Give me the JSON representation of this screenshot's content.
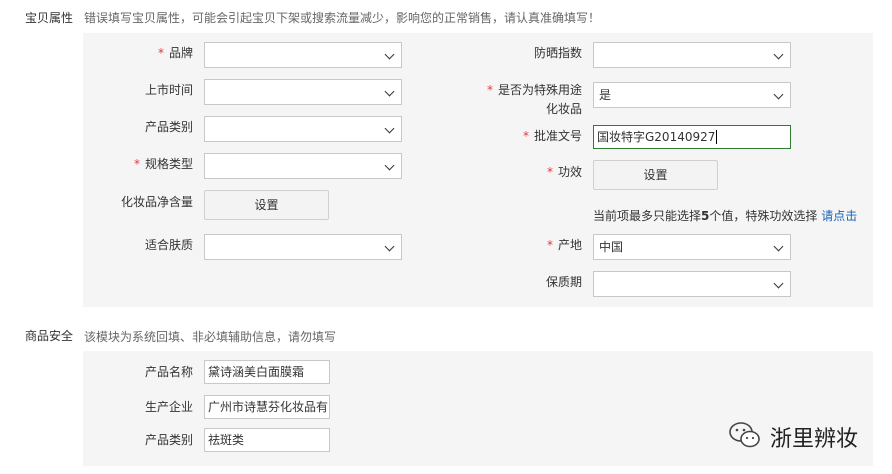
{
  "attributes": {
    "title": "宝贝属性",
    "warning": "错误填写宝贝属性，可能会引起宝贝下架或搜索流量减少，影响您的正常销售，请认真准确填写！",
    "left": {
      "brand": {
        "label": "品牌",
        "value": ""
      },
      "launch_time": {
        "label": "上市时间",
        "value": ""
      },
      "product_category": {
        "label": "产品类别",
        "value": ""
      },
      "spec_type": {
        "label": "规格类型",
        "value": ""
      },
      "net_content": {
        "label": "化妆品净含量",
        "button": "设置"
      },
      "skin_type": {
        "label": "适合肤质",
        "value": ""
      }
    },
    "right": {
      "spf": {
        "label": "防晒指数",
        "value": ""
      },
      "special_use": {
        "label_line1": "是否为特殊用途",
        "label_line2": "化妆品",
        "value": "是"
      },
      "approval_no": {
        "label": "批准文号",
        "value": "国妆特字G20140927"
      },
      "efficacy": {
        "label": "功效",
        "button": "设置"
      },
      "efficacy_hint": {
        "prefix": "当前项最多只能选择",
        "count": "5",
        "suffix": "个值，特殊功效选择",
        "link": "请点击"
      },
      "origin": {
        "label": "产地",
        "value": "中国"
      },
      "shelf_life": {
        "label": "保质期",
        "value": ""
      }
    }
  },
  "safety": {
    "title": "商品安全",
    "note": "该模块为系统回填、非必填辅助信息，请勿填写",
    "product_name": {
      "label": "产品名称",
      "value": "黛诗涵美白面膜霜"
    },
    "manufacturer": {
      "label": "生产企业",
      "value": "广州市诗慧芬化妆品有限公司"
    },
    "product_category": {
      "label": "产品类别",
      "value": "祛斑类"
    }
  },
  "watermark": {
    "text": "浙里辨妆",
    "icon": "wechat-icon"
  }
}
